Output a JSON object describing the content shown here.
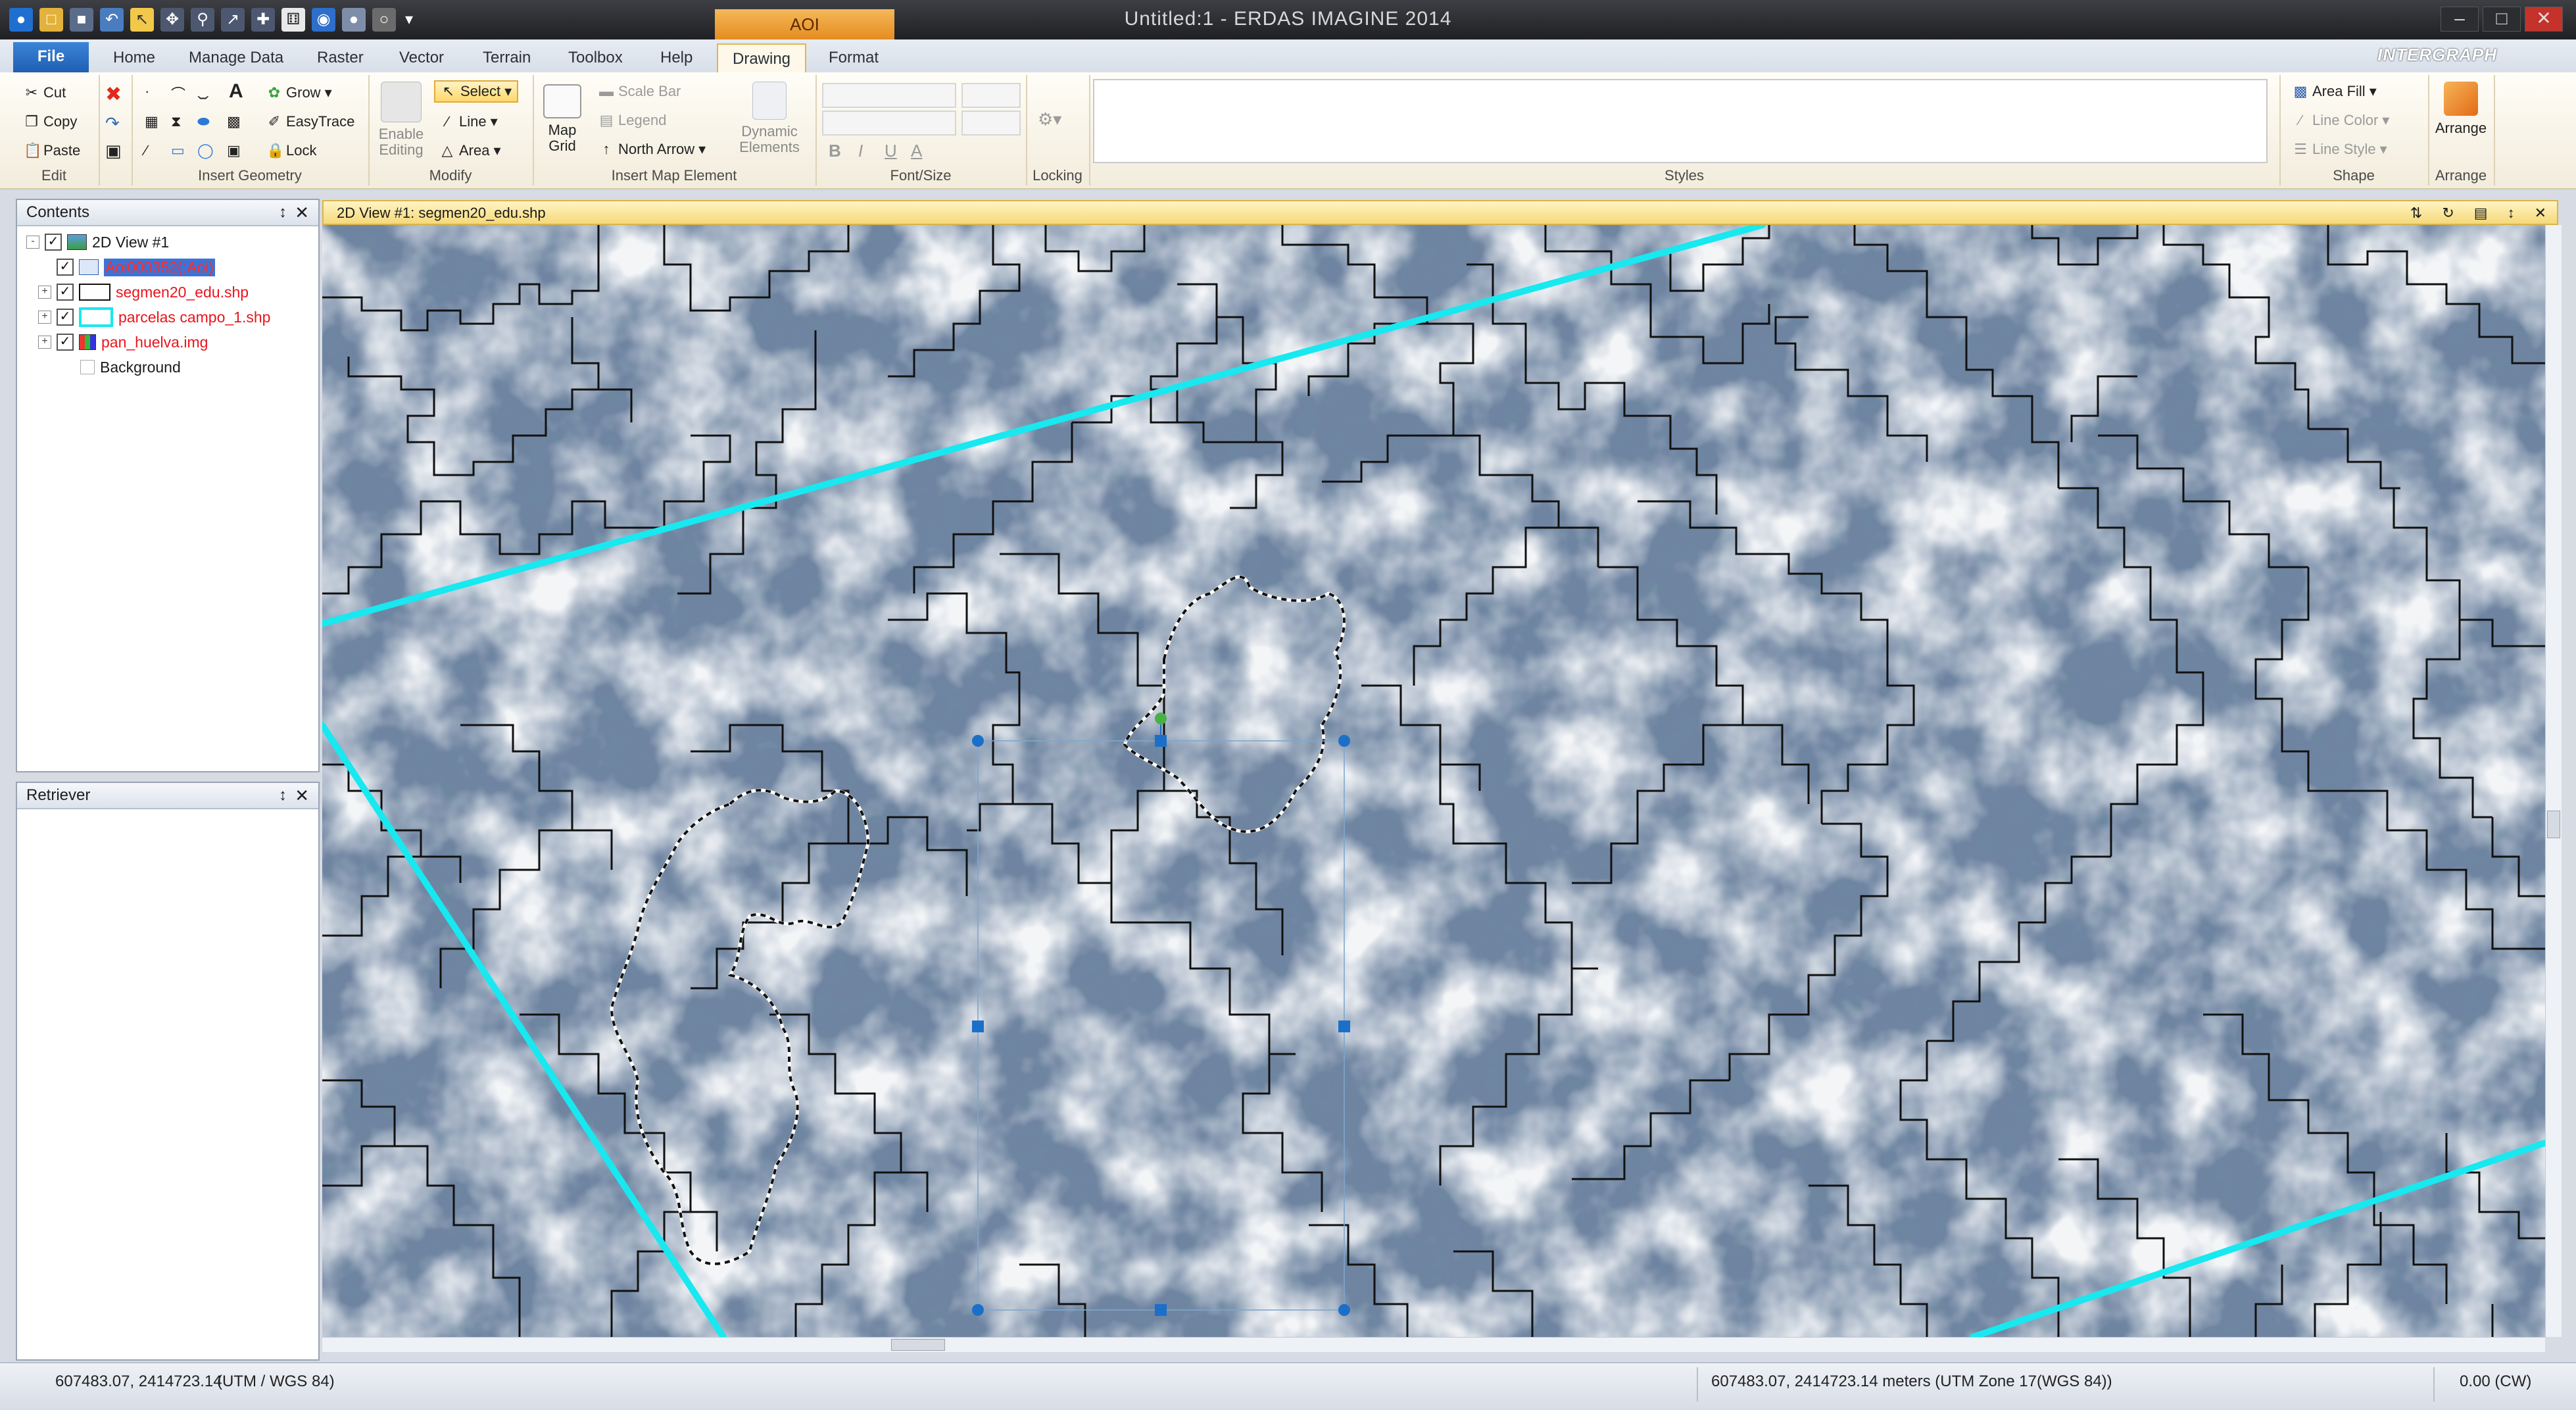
{
  "window": {
    "title": "Untitled:1 - ERDAS IMAGINE 2014",
    "context_tab": "AOI",
    "brand": "INTERGRAPH",
    "controls": [
      "–",
      "□",
      "✕"
    ]
  },
  "ribbon_tabs": [
    {
      "label": "File"
    },
    {
      "label": "Home"
    },
    {
      "label": "Manage Data"
    },
    {
      "label": "Raster"
    },
    {
      "label": "Vector"
    },
    {
      "label": "Terrain"
    },
    {
      "label": "Toolbox"
    },
    {
      "label": "Help"
    },
    {
      "label": "Drawing"
    },
    {
      "label": "Format"
    }
  ],
  "ribbon": {
    "edit": {
      "label": "Edit",
      "cut": "Cut",
      "copy": "Copy",
      "paste": "Paste"
    },
    "insert_geometry": {
      "label": "Insert Geometry",
      "grow": "Grow",
      "easytrace": "EasyTrace",
      "lock": "Lock"
    },
    "modify": {
      "label": "Modify",
      "enable_editing": "Enable Editing",
      "select": "Select",
      "line": "Line",
      "area": "Area"
    },
    "insert_map_element": {
      "label": "Insert Map Element",
      "map_grid": "Map Grid",
      "scale_bar": "Scale Bar",
      "legend": "Legend",
      "north_arrow": "North Arrow",
      "dynamic_elements": "Dynamic Elements"
    },
    "font_size": {
      "label": "Font/Size",
      "bold": "B",
      "italic": "I",
      "underline": "U",
      "color": "A"
    },
    "locking": {
      "label": "Locking"
    },
    "styles": {
      "label": "Styles"
    },
    "shape": {
      "label": "Shape",
      "area_fill": "Area Fill",
      "line_color": "Line Color",
      "line_style": "Line Style"
    },
    "arrange": {
      "label": "Arrange",
      "button": "Arrange"
    }
  },
  "contents": {
    "title": "Contents",
    "items": [
      {
        "label": "2D View #1",
        "checked": true
      },
      {
        "label": "Aoi000352(:Aoi)",
        "checked": true
      },
      {
        "label": "segmen20_edu.shp",
        "checked": true
      },
      {
        "label": "parcelas campo_1.shp",
        "checked": true
      },
      {
        "label": "pan_huelva.img",
        "checked": true
      },
      {
        "label": "Background",
        "checked": false
      }
    ]
  },
  "retriever": {
    "title": "Retriever"
  },
  "view": {
    "title": "2D View #1: segmen20_edu.shp"
  },
  "status": {
    "left_coords": "607483.07, 2414723.14",
    "left_crs": "(UTM / WGS 84)",
    "right_coords": "607483.07, 2414723.14 meters (UTM Zone 17(WGS 84))",
    "rotation": "0.00 (CW)"
  },
  "colors": {
    "segment_lines": "#111111",
    "parcel_lines": "#18e8f0",
    "aoi_selection": "#1c6fc9",
    "aoi_handle_rotate": "#49b044",
    "context_tab": "#f0a43a",
    "layer_label_red": "#e8151c"
  },
  "panel_glyphs": {
    "pin": "↕",
    "close": "✕",
    "expand": "+",
    "collapse": "-"
  }
}
